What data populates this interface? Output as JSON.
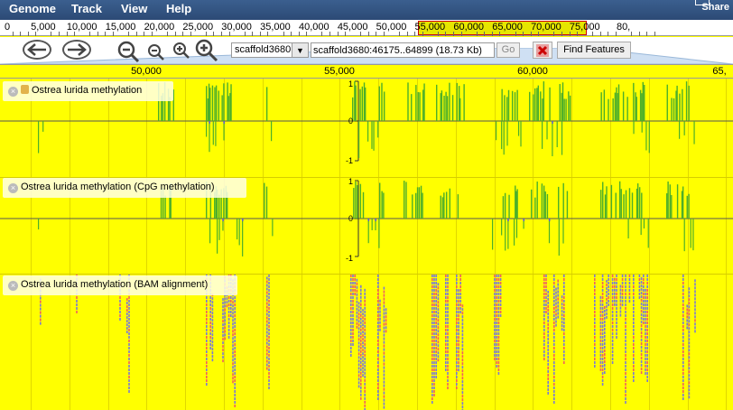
{
  "menu": {
    "items": [
      "Genome",
      "Track",
      "View",
      "Help"
    ],
    "share_label": "Share"
  },
  "overview": {
    "ticks": [
      "0",
      "5,000",
      "10,000",
      "15,000",
      "20,000",
      "25,000",
      "30,000",
      "35,000",
      "40,000",
      "45,000",
      "50,000",
      "55,000",
      "60,000",
      "65,000",
      "70,000",
      "75,000",
      "80,"
    ]
  },
  "toolbar": {
    "ref_seq": "scaffold3680",
    "location": "scaffold3680:46175..64899 (18.73 Kb)",
    "go_label": "Go",
    "find_label": "Find Features"
  },
  "scale": {
    "ticks": [
      "50,000",
      "55,000",
      "60,000",
      "65,"
    ]
  },
  "tracks": [
    {
      "label": "Ostrea lurida methylation",
      "axis": [
        "1",
        "0",
        "-1"
      ]
    },
    {
      "label": "Ostrea lurida methylation (CpG methylation)",
      "axis": [
        "1",
        "0",
        "-1"
      ]
    },
    {
      "label": "Ostrea lurida methylation (BAM alignment)"
    }
  ],
  "colors": {
    "background": "#ffff00",
    "signal": "#4caf2a",
    "read_blue": "#7a7ad6",
    "read_red": "#f06060",
    "menubar": "#2c4a75"
  }
}
